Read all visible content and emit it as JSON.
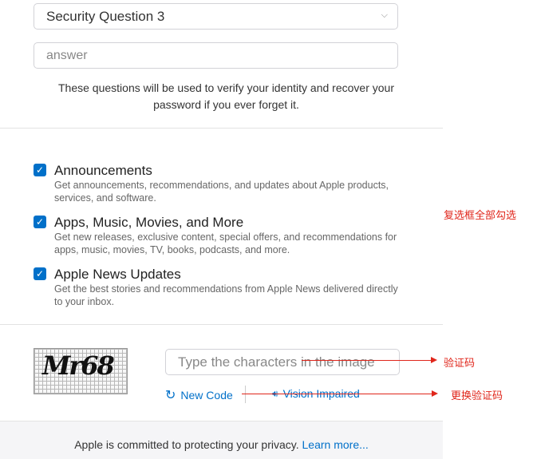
{
  "security": {
    "question_label": "Security Question 3",
    "answer_placeholder": "answer",
    "note": "These questions will be used to verify your identity and recover your password if you ever forget it."
  },
  "options": [
    {
      "title": "Announcements",
      "desc": "Get announcements, recommendations, and updates about Apple products, services, and software.",
      "checked": true
    },
    {
      "title": "Apps, Music, Movies, and More",
      "desc": "Get new releases, exclusive content, special offers, and recommendations for apps, music, movies, TV, books, podcasts, and more.",
      "checked": true
    },
    {
      "title": "Apple News Updates",
      "desc": "Get the best stories and recommendations from Apple News delivered directly to your inbox.",
      "checked": true
    }
  ],
  "captcha": {
    "image_text": "Mr68",
    "input_placeholder": "Type the characters in the image",
    "new_code_label": "New Code",
    "vision_label": "Vision Impaired"
  },
  "footer": {
    "text": "Apple is committed to protecting your privacy.",
    "link": "Learn more..."
  },
  "annotations": {
    "checkboxes": "复选框全部勾选",
    "captcha": "验证码",
    "change_code": "更换验证码"
  },
  "colors": {
    "accent": "#0070c9",
    "annotation": "#e0261b"
  }
}
